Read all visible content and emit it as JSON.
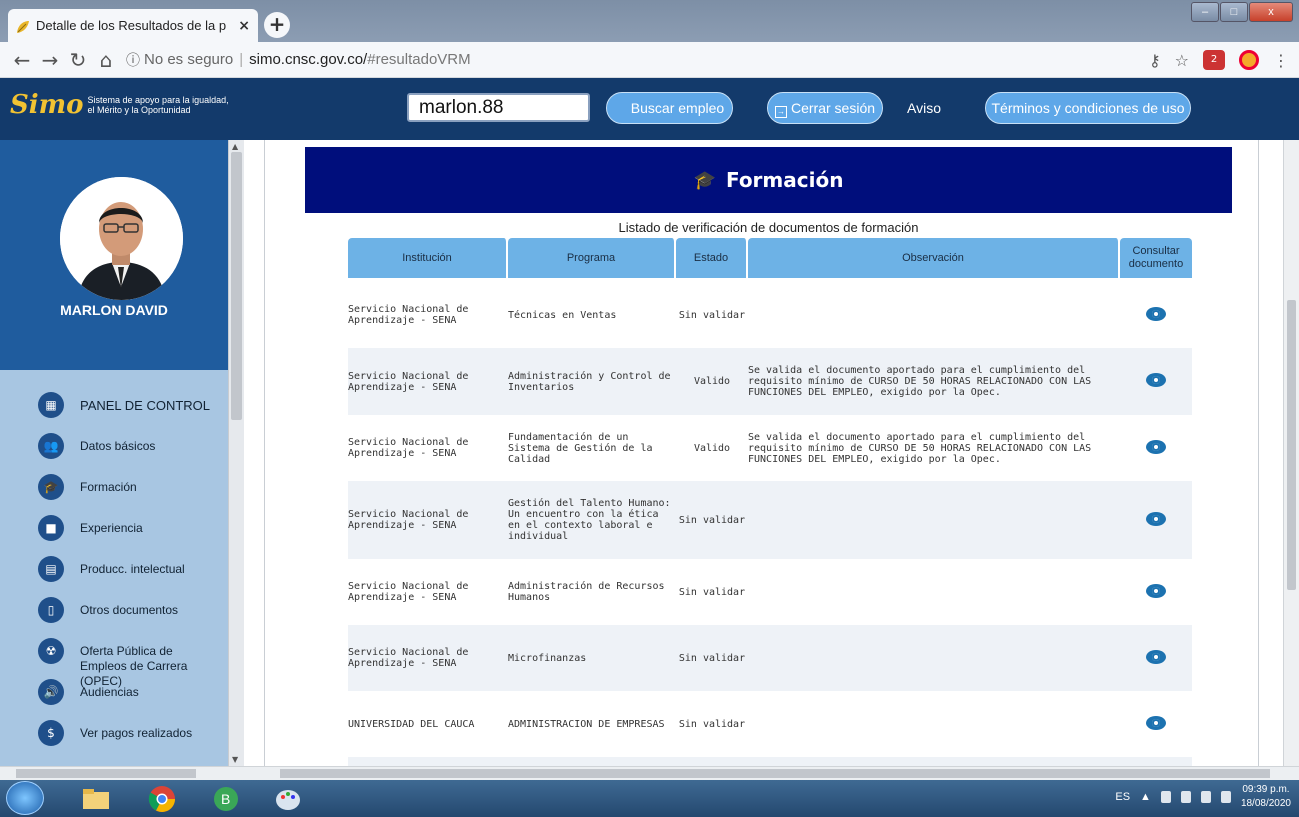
{
  "browser": {
    "tab_title": "Detalle de los Resultados de la p",
    "tab_close": "×",
    "new_tab": "+",
    "security_label": "No es seguro",
    "url_host": "simo.cnsc.gov.co/",
    "url_path": "#resultadoVRM"
  },
  "header": {
    "logo_mark": "Simo",
    "logo_line1": "Sistema de apoyo para la igualdad,",
    "logo_line2": "el Mérito y la Oportunidad",
    "username": "marlon.88",
    "search_label": "Buscar empleo",
    "logout_label": "Cerrar sesión",
    "aviso_label": "Aviso",
    "terms_label": "Términos y condiciones de uso"
  },
  "sidebar": {
    "user_name": "MARLON DAVID",
    "items": [
      {
        "label": "PANEL DE CONTROL",
        "icon": "grid-icon"
      },
      {
        "label": "Datos básicos",
        "icon": "people-icon"
      },
      {
        "label": "Formación",
        "icon": "graduation-icon"
      },
      {
        "label": "Experiencia",
        "icon": "briefcase-icon"
      },
      {
        "label": "Producc. intelectual",
        "icon": "book-icon"
      },
      {
        "label": "Otros documentos",
        "icon": "document-icon"
      },
      {
        "label": "Oferta Pública de",
        "label2": "Empleos de Carrera (OPEC)",
        "icon": "radiation-icon"
      },
      {
        "label": "Audiencias",
        "icon": "speaker-icon"
      },
      {
        "label": "Ver pagos realizados",
        "icon": "dollar-icon"
      }
    ]
  },
  "panel": {
    "title": "Formación",
    "caption": "Listado de verificación de documentos de formación",
    "columns": [
      "Institución",
      "Programa",
      "Estado",
      "Observación",
      "Consultar documento"
    ],
    "rows": [
      {
        "institucion": "Servicio Nacional de Aprendizaje - SENA",
        "programa": "Técnicas en Ventas",
        "estado": "Sin validar",
        "observacion": ""
      },
      {
        "institucion": "Servicio Nacional de Aprendizaje - SENA",
        "programa": "Administración y Control de Inventarios",
        "estado": "Valido",
        "observacion": "Se valida el documento aportado para el cumplimiento del requisito mínimo de CURSO DE 50 HORAS RELACIONADO CON LAS FUNCIONES DEL EMPLEO, exigido por la Opec."
      },
      {
        "institucion": "Servicio Nacional de Aprendizaje - SENA",
        "programa": "Fundamentación de un Sistema de Gestión de la Calidad",
        "estado": "Valido",
        "observacion": "Se valida el documento aportado para el cumplimiento del requisito mínimo de CURSO DE 50 HORAS RELACIONADO CON LAS FUNCIONES DEL EMPLEO, exigido por la Opec."
      },
      {
        "institucion": "Servicio Nacional de Aprendizaje - SENA",
        "programa": "Gestión del Talento Humano: Un encuentro con la ética en el contexto laboral e individual",
        "estado": "Sin validar",
        "observacion": ""
      },
      {
        "institucion": "Servicio Nacional de Aprendizaje - SENA",
        "programa": "Administración de Recursos Humanos",
        "estado": "Sin validar",
        "observacion": ""
      },
      {
        "institucion": "Servicio Nacional de Aprendizaje - SENA",
        "programa": "Microfinanzas",
        "estado": "Sin validar",
        "observacion": ""
      },
      {
        "institucion": "UNIVERSIDAD DEL CAUCA",
        "programa": "ADMINISTRACION DE EMPRESAS",
        "estado": "Sin validar",
        "observacion": ""
      }
    ]
  },
  "taskbar": {
    "lang": "ES",
    "time": "09:39 p.m.",
    "date": "18/08/2020"
  }
}
